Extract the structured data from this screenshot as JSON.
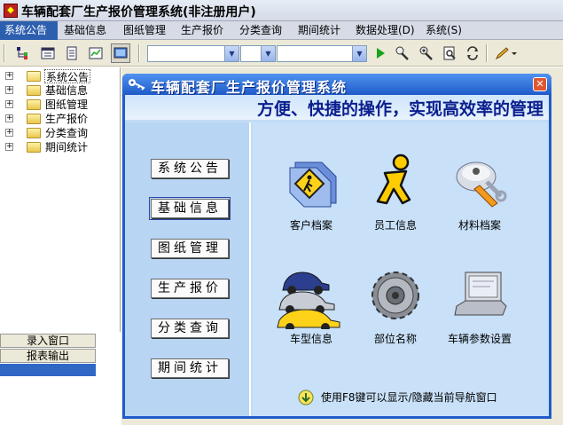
{
  "window": {
    "title": "车辆配套厂生产报价管理系统(非注册用户)"
  },
  "menu": [
    {
      "label": "系统公告",
      "active": true
    },
    {
      "label": "基础信息"
    },
    {
      "label": "图纸管理"
    },
    {
      "label": "生产报价"
    },
    {
      "label": "分类查询"
    },
    {
      "label": "期间统计"
    },
    {
      "label": "数据处理(D)"
    },
    {
      "label": "系统(S)"
    }
  ],
  "toolbar": {
    "icons": [
      "tree-edit-icon",
      "window-icon",
      "document-icon",
      "chart-icon",
      "display-icon",
      "run-icon",
      "find-user-icon",
      "search-user-icon",
      "preview-icon",
      "refresh-icon",
      "pencil-icon"
    ],
    "combo1": "",
    "combo2": "",
    "combo3": ""
  },
  "tree": {
    "items": [
      {
        "label": "系统公告",
        "open": true,
        "selected": true
      },
      {
        "label": "基础信息"
      },
      {
        "label": "图纸管理"
      },
      {
        "label": "生产报价"
      },
      {
        "label": "分类查询"
      },
      {
        "label": "期间统计"
      }
    ]
  },
  "left_panel": {
    "buttons": [
      "录入窗口",
      "报表输出"
    ]
  },
  "dialog": {
    "title": "车辆配套厂生产报价管理系统",
    "slogan": "方便、快捷的操作，实现高效率的管理",
    "nav_buttons": [
      "系统公告",
      "基础信息",
      "图纸管理",
      "生产报价",
      "分类查询",
      "期间统计"
    ],
    "focused_nav": "基础信息",
    "tiles": [
      {
        "label": "客户档案",
        "icon": "customer-folder-icon"
      },
      {
        "label": "员工信息",
        "icon": "employee-running-man-icon"
      },
      {
        "label": "材料档案",
        "icon": "material-tools-icon"
      },
      {
        "label": "车型信息",
        "icon": "car-models-icon"
      },
      {
        "label": "部位名称",
        "icon": "gear-parts-icon"
      },
      {
        "label": "车辆参数设置",
        "icon": "laptop-settings-icon"
      }
    ],
    "hint": "使用F8键可以显示/隐藏当前导航窗口"
  },
  "colors": {
    "dialog_blue": "#1f5bc9",
    "panel_bg": "#c2dcf6",
    "menu_active": "#2d5faf",
    "slogan": "#0a1e8e"
  }
}
